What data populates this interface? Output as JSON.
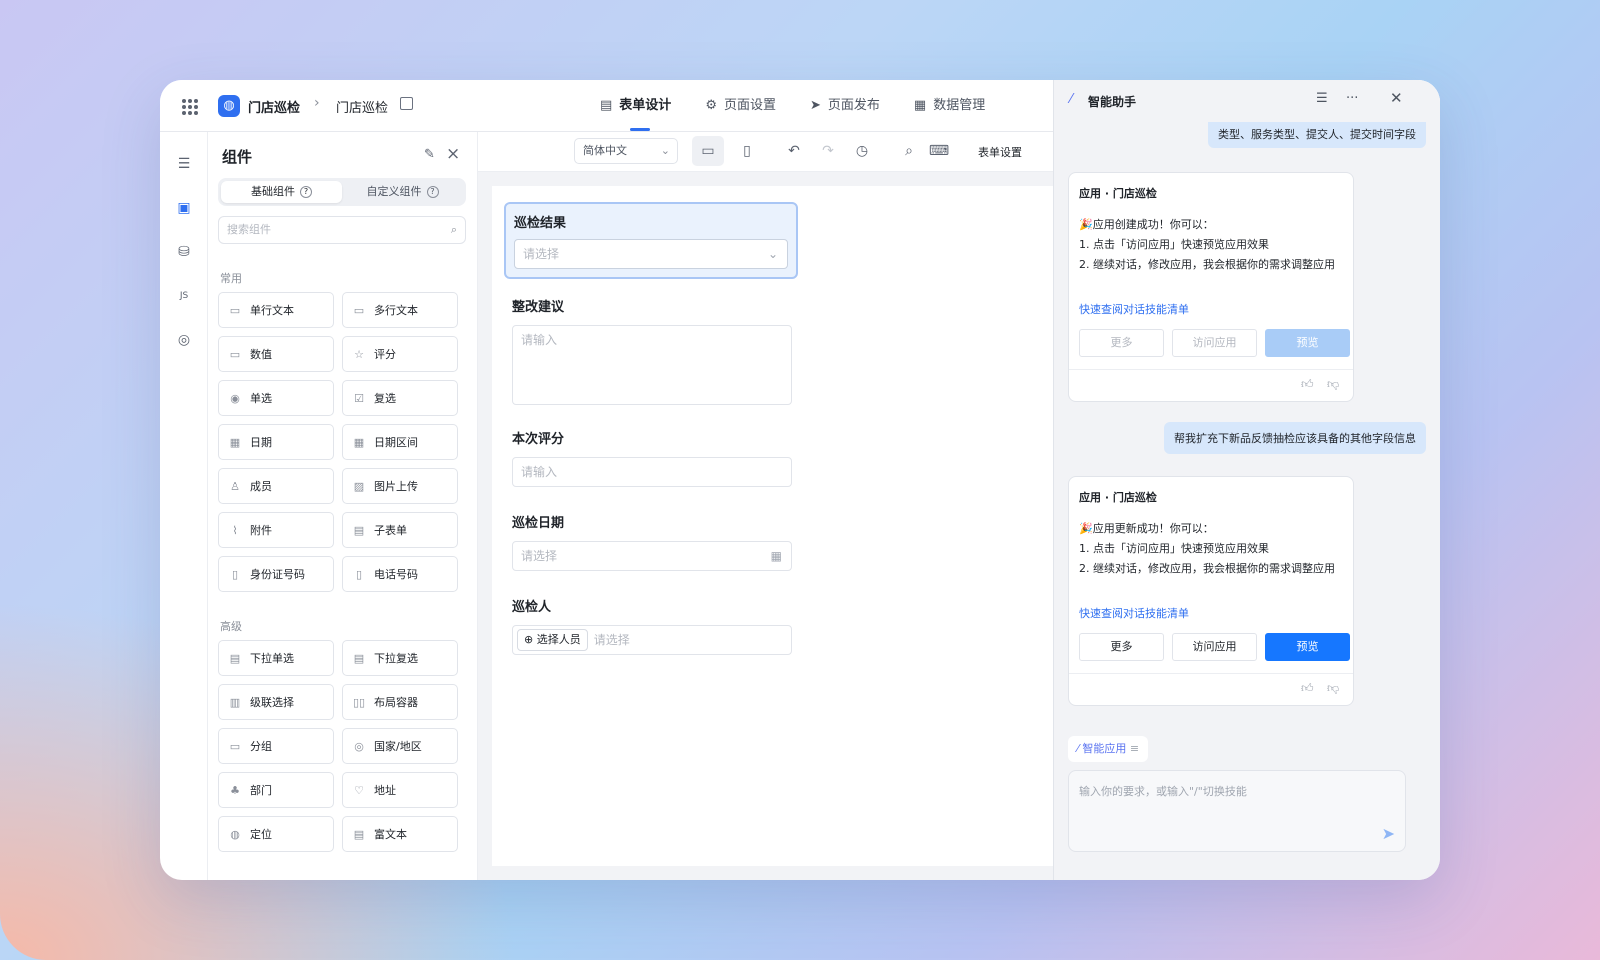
{
  "header": {
    "app_name": "门店巡检",
    "breadcrumb_sep": "›",
    "page_name": "门店巡检",
    "tabs": [
      {
        "label": "表单设计",
        "icon": "document-icon"
      },
      {
        "label": "页面设置",
        "icon": "gear-icon"
      },
      {
        "label": "页面发布",
        "icon": "send-icon"
      },
      {
        "label": "数据管理",
        "icon": "table-icon"
      }
    ]
  },
  "panel": {
    "title": "组件",
    "seg_basic": "基础组件",
    "seg_custom": "自定义组件",
    "search_placeholder": "搜索组件",
    "common_title": "常用",
    "common": [
      "单行文本",
      "多行文本",
      "数值",
      "评分",
      "单选",
      "复选",
      "日期",
      "日期区间",
      "成员",
      "图片上传",
      "附件",
      "子表单",
      "身份证号码",
      "电话号码"
    ],
    "advanced_title": "高级",
    "advanced": [
      "下拉单选",
      "下拉复选",
      "级联选择",
      "布局容器",
      "分组",
      "国家/地区",
      "部门",
      "地址",
      "定位",
      "富文本"
    ]
  },
  "toolbar": {
    "language": "简体中文",
    "form_settings": "表单设置"
  },
  "form": {
    "fields": [
      {
        "label": "巡检结果",
        "placeholder": "请选择"
      },
      {
        "label": "整改建议",
        "placeholder": "请输入"
      },
      {
        "label": "本次评分",
        "placeholder": "请输入"
      },
      {
        "label": "巡检日期",
        "placeholder": "请选择"
      },
      {
        "label": "巡检人",
        "placeholder": "请选择",
        "button": "选择人员"
      }
    ]
  },
  "assistant": {
    "title": "智能助手",
    "msg_top": "类型、服务类型、提交人、提交时间字段",
    "cards": [
      {
        "title": "应用 · 门店巡检",
        "lines": [
          "🎉应用创建成功！你可以：",
          "1. 点击「访问应用」快速预览应用效果",
          "2. 继续对话，修改应用，我会根据你的需求调整应用"
        ],
        "link": "快速查阅对话技能清单",
        "btn_more": "更多",
        "btn_visit": "访问应用",
        "btn_preview": "预览"
      },
      {
        "title": "应用 · 门店巡检",
        "lines": [
          "🎉应用更新成功！你可以：",
          "1. 点击「访问应用」快速预览应用效果",
          "2. 继续对话，修改应用，我会根据你的需求调整应用"
        ],
        "link": "快速查阅对话技能清单",
        "btn_more": "更多",
        "btn_visit": "访问应用",
        "btn_preview": "预览"
      }
    ],
    "msg_user": "帮我扩充下新品反馈抽检应该具备的其他字段信息",
    "skill_chip": "智能应用",
    "composer_placeholder": "输入你的要求，或输入\"/\"切换技能"
  }
}
